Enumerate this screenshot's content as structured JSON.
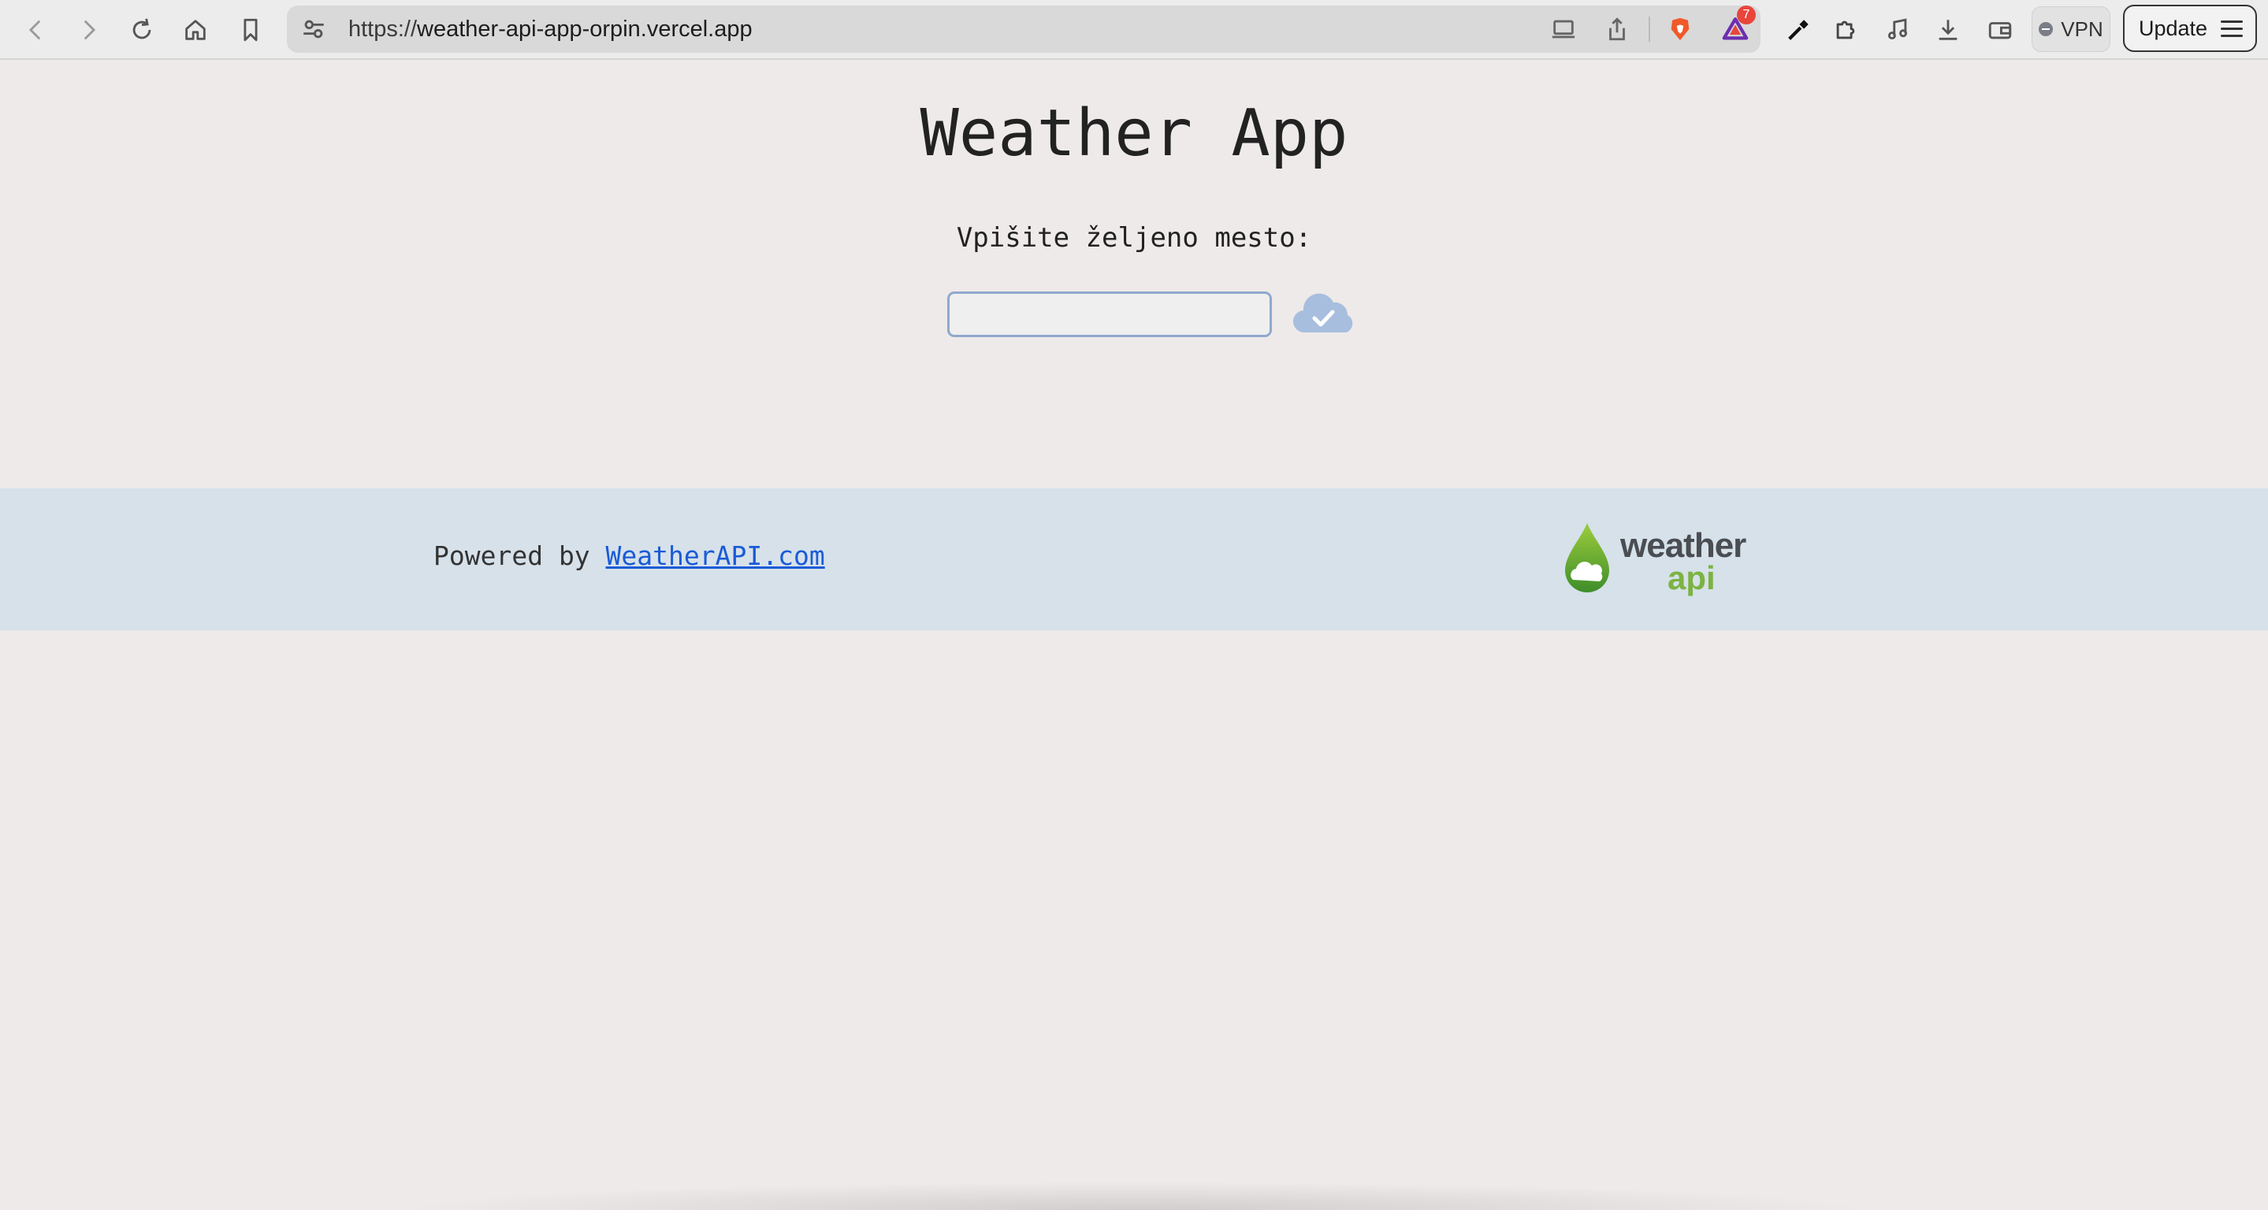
{
  "browser": {
    "url_scheme": "https://",
    "url_host": "weather-api-app-orpin.vercel.app",
    "notification_count": "7",
    "vpn_label": "VPN",
    "update_label": "Update",
    "icons": [
      "back-icon",
      "forward-icon",
      "reload-icon",
      "home-icon",
      "bookmark-icon",
      "site-settings-icon",
      "cast-icon",
      "share-icon",
      "brave-shields-icon",
      "brave-rewards-icon",
      "eyedropper-icon",
      "extensions-icon",
      "media-icon",
      "downloads-icon",
      "wallet-icon",
      "menu-icon"
    ]
  },
  "page": {
    "title": "Weather App",
    "prompt": "Vpišite željeno mesto:",
    "city_input_value": "",
    "submit_icon": "cloud-check-icon",
    "colors": {
      "background": "#eeeae9",
      "footer": "#d6e1ea",
      "link": "#1a5bd6",
      "cloud_button": "#a7bedf"
    }
  },
  "footer": {
    "powered_prefix": "Powered by ",
    "powered_link": "WeatherAPI.com",
    "logo_word1": "weather",
    "logo_word2": "api"
  }
}
